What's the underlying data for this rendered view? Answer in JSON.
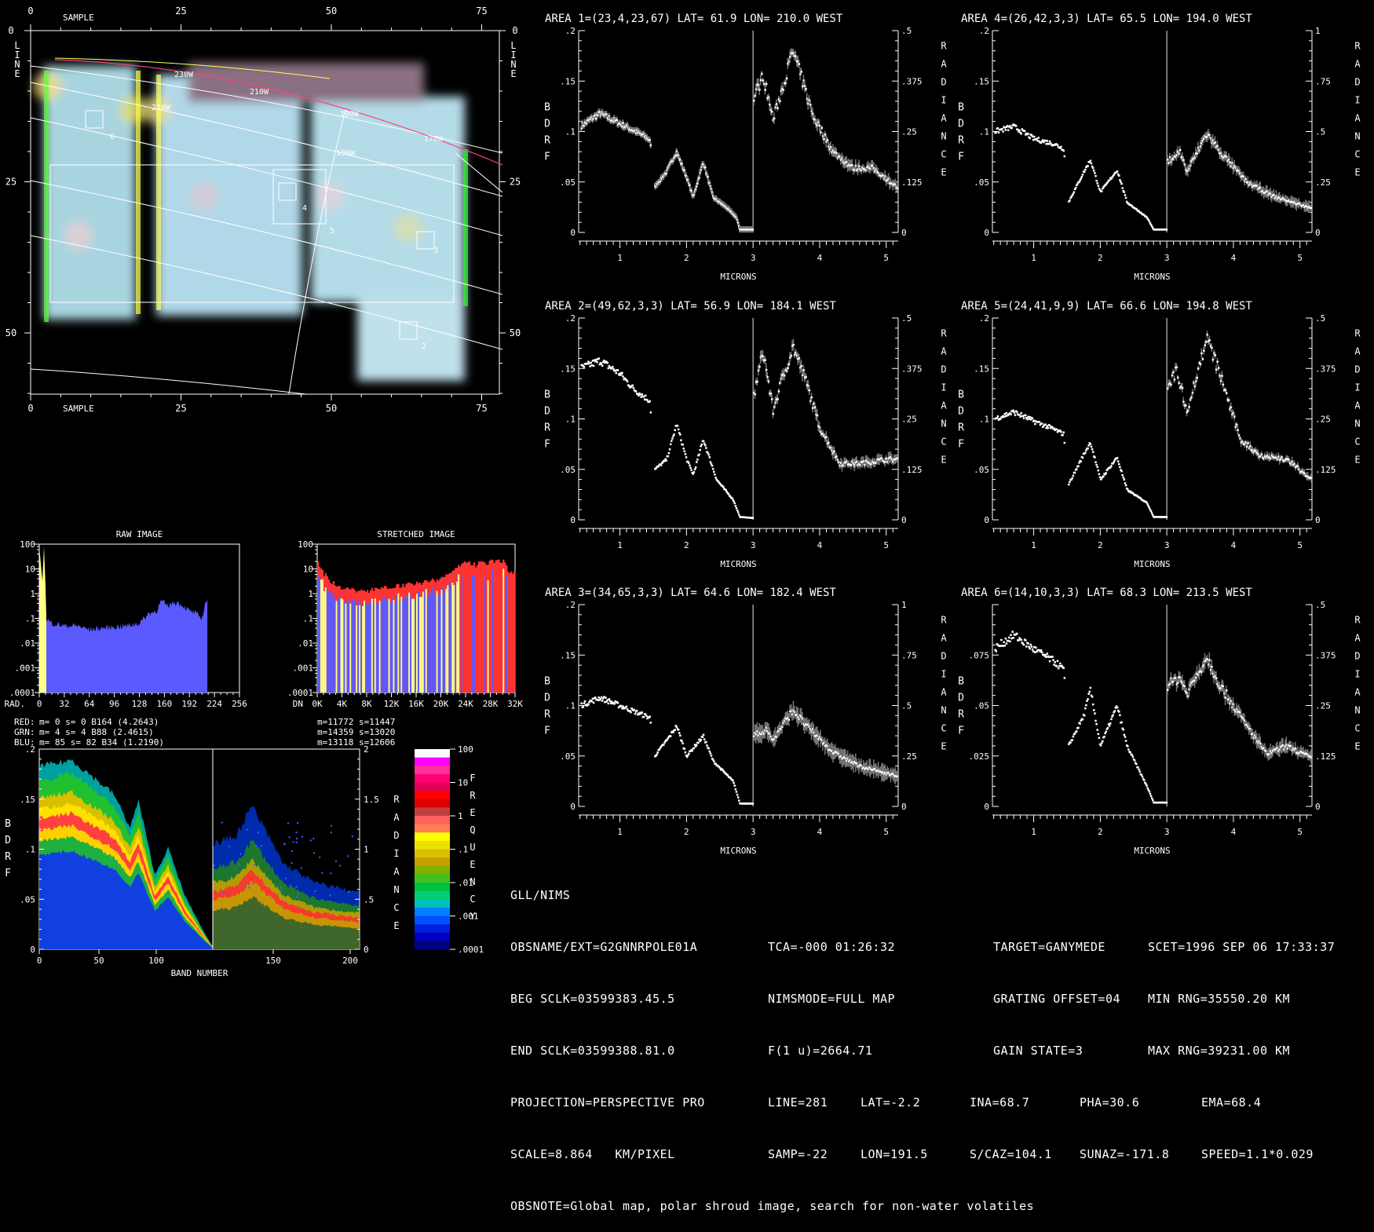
{
  "map": {
    "x_label": "SAMPLE",
    "y_label": "LINE",
    "x_ticks": [
      0,
      25,
      50,
      75
    ],
    "y_ticks": [
      0,
      25,
      50
    ],
    "longitude_labels": [
      "230W",
      "210W",
      "210W",
      "190W",
      "170W",
      "190W"
    ],
    "box_labels": [
      "6",
      "4",
      "5",
      "3",
      "2"
    ]
  },
  "spectrum_axes": {
    "xlabel": "MICRONS",
    "left_label": "BDRF",
    "right_label": "RADIANCE",
    "x_ticks": [
      1,
      2,
      3,
      4,
      5
    ],
    "x_range": [
      0.38,
      5.18
    ]
  },
  "areas": [
    {
      "title": "AREA 1=(23,4,23,67) LAT=  61.9 LON= 210.0 WEST",
      "bdrf_max": 0.2,
      "radiance_max": 0.5,
      "left_ticks": [
        ".2",
        ".15",
        ".1",
        ".05",
        "0"
      ],
      "right_ticks": [
        ".5",
        ".375",
        ".25",
        ".125",
        "0"
      ],
      "error": 0.02,
      "bdrf": [
        [
          0.4,
          0.105
        ],
        [
          0.7,
          0.118
        ],
        [
          1.0,
          0.108
        ],
        [
          1.3,
          0.098
        ],
        [
          1.45,
          0.092
        ],
        [
          1.52,
          0.045
        ],
        [
          1.7,
          0.06
        ],
        [
          1.85,
          0.08
        ],
        [
          2.0,
          0.055
        ],
        [
          2.1,
          0.035
        ],
        [
          2.25,
          0.07
        ],
        [
          2.4,
          0.035
        ],
        [
          2.6,
          0.025
        ],
        [
          2.75,
          0.015
        ],
        [
          2.8,
          0.003
        ],
        [
          3.0,
          0.003
        ]
      ],
      "radiance": [
        [
          3.0,
          0.33
        ],
        [
          3.15,
          0.39
        ],
        [
          3.3,
          0.28
        ],
        [
          3.6,
          0.45
        ],
        [
          3.9,
          0.29
        ],
        [
          4.2,
          0.2
        ],
        [
          4.5,
          0.16
        ],
        [
          4.8,
          0.16
        ],
        [
          5.18,
          0.11
        ]
      ]
    },
    {
      "title": "AREA 2=(49,62,3,3) LAT=  56.9 LON= 184.1 WEST",
      "bdrf_max": 0.2,
      "radiance_max": 0.5,
      "left_ticks": [
        ".2",
        ".15",
        ".1",
        ".05",
        "0"
      ],
      "right_ticks": [
        ".5",
        ".375",
        ".25",
        ".125",
        "0"
      ],
      "error": 0.02,
      "bdrf": [
        [
          0.4,
          0.15
        ],
        [
          0.7,
          0.158
        ],
        [
          1.0,
          0.145
        ],
        [
          1.2,
          0.13
        ],
        [
          1.45,
          0.118
        ],
        [
          1.52,
          0.05
        ],
        [
          1.7,
          0.06
        ],
        [
          1.85,
          0.095
        ],
        [
          2.0,
          0.06
        ],
        [
          2.1,
          0.045
        ],
        [
          2.25,
          0.08
        ],
        [
          2.45,
          0.04
        ],
        [
          2.7,
          0.02
        ],
        [
          2.8,
          0.003
        ],
        [
          3.0,
          0.002
        ]
      ],
      "radiance": [
        [
          3.0,
          0.3
        ],
        [
          3.15,
          0.42
        ],
        [
          3.3,
          0.27
        ],
        [
          3.4,
          0.33
        ],
        [
          3.6,
          0.43
        ],
        [
          3.8,
          0.34
        ],
        [
          4.0,
          0.23
        ],
        [
          4.3,
          0.14
        ],
        [
          4.6,
          0.14
        ],
        [
          5.0,
          0.15
        ],
        [
          5.18,
          0.15
        ]
      ]
    },
    {
      "title": "AREA 3=(34,65,3,3) LAT=  64.6 LON= 182.4 WEST",
      "bdrf_max": 0.2,
      "radiance_max": 1,
      "left_ticks": [
        ".2",
        ".15",
        ".1",
        ".05",
        "0"
      ],
      "right_ticks": [
        "1",
        ".75",
        ".5",
        ".25",
        "0"
      ],
      "error": 0.03,
      "bdrf": [
        [
          0.4,
          0.1
        ],
        [
          0.7,
          0.108
        ],
        [
          1.0,
          0.1
        ],
        [
          1.3,
          0.092
        ],
        [
          1.45,
          0.088
        ],
        [
          1.52,
          0.05
        ],
        [
          1.75,
          0.07
        ],
        [
          1.85,
          0.08
        ],
        [
          2.0,
          0.05
        ],
        [
          2.25,
          0.07
        ],
        [
          2.4,
          0.045
        ],
        [
          2.7,
          0.025
        ],
        [
          2.8,
          0.003
        ],
        [
          3.0,
          0.003
        ]
      ],
      "radiance": [
        [
          3.0,
          0.35
        ],
        [
          3.2,
          0.38
        ],
        [
          3.3,
          0.33
        ],
        [
          3.6,
          0.48
        ],
        [
          3.8,
          0.4
        ],
        [
          4.2,
          0.27
        ],
        [
          4.6,
          0.2
        ],
        [
          5.18,
          0.15
        ]
      ]
    },
    {
      "title": "AREA 4=(26,42,3,3) LAT=  65.5 LON= 194.0 WEST",
      "bdrf_max": 0.2,
      "radiance_max": 1,
      "left_ticks": [
        ".2",
        ".15",
        ".1",
        ".05",
        "0"
      ],
      "right_ticks": [
        "1",
        ".75",
        ".5",
        ".25",
        "0"
      ],
      "error": 0.02,
      "bdrf": [
        [
          0.4,
          0.1
        ],
        [
          0.7,
          0.105
        ],
        [
          1.0,
          0.093
        ],
        [
          1.3,
          0.088
        ],
        [
          1.45,
          0.083
        ],
        [
          1.52,
          0.03
        ],
        [
          1.75,
          0.06
        ],
        [
          1.85,
          0.072
        ],
        [
          2.0,
          0.04
        ],
        [
          2.25,
          0.062
        ],
        [
          2.4,
          0.03
        ],
        [
          2.7,
          0.015
        ],
        [
          2.8,
          0.003
        ],
        [
          3.0,
          0.003
        ]
      ],
      "radiance": [
        [
          3.0,
          0.35
        ],
        [
          3.2,
          0.4
        ],
        [
          3.3,
          0.3
        ],
        [
          3.6,
          0.49
        ],
        [
          3.8,
          0.4
        ],
        [
          4.2,
          0.25
        ],
        [
          4.6,
          0.18
        ],
        [
          5.18,
          0.12
        ]
      ]
    },
    {
      "title": "AREA 5=(24,41,9,9) LAT=  66.6 LON= 194.8 WEST",
      "bdrf_max": 0.2,
      "radiance_max": 0.5,
      "left_ticks": [
        ".2",
        ".15",
        ".1",
        ".05",
        "0"
      ],
      "right_ticks": [
        ".5",
        ".375",
        ".25",
        ".125",
        "0"
      ],
      "error": 0.015,
      "bdrf": [
        [
          0.4,
          0.1
        ],
        [
          0.7,
          0.107
        ],
        [
          1.0,
          0.098
        ],
        [
          1.3,
          0.09
        ],
        [
          1.45,
          0.085
        ],
        [
          1.52,
          0.035
        ],
        [
          1.75,
          0.065
        ],
        [
          1.85,
          0.077
        ],
        [
          2.0,
          0.04
        ],
        [
          2.25,
          0.062
        ],
        [
          2.4,
          0.03
        ],
        [
          2.7,
          0.017
        ],
        [
          2.8,
          0.003
        ],
        [
          3.0,
          0.003
        ]
      ],
      "radiance": [
        [
          3.0,
          0.33
        ],
        [
          3.15,
          0.37
        ],
        [
          3.3,
          0.27
        ],
        [
          3.6,
          0.45
        ],
        [
          3.8,
          0.36
        ],
        [
          4.1,
          0.2
        ],
        [
          4.4,
          0.16
        ],
        [
          4.8,
          0.15
        ],
        [
          5.18,
          0.1
        ]
      ]
    },
    {
      "title": "AREA 6=(14,10,3,3) LAT=  68.3 LON= 213.5 WEST",
      "bdrf_max": 0.1,
      "radiance_max": 0.5,
      "left_ticks": [
        "",
        ".075",
        ".05",
        ".025",
        "0"
      ],
      "right_ticks": [
        ".5",
        ".375",
        ".25",
        ".125",
        "0"
      ],
      "error": 0.025,
      "bdrf": [
        [
          0.4,
          0.078
        ],
        [
          0.7,
          0.085
        ],
        [
          1.0,
          0.078
        ],
        [
          1.3,
          0.072
        ],
        [
          1.45,
          0.068
        ],
        [
          1.52,
          0.03
        ],
        [
          1.75,
          0.045
        ],
        [
          1.85,
          0.058
        ],
        [
          2.0,
          0.03
        ],
        [
          2.25,
          0.05
        ],
        [
          2.4,
          0.03
        ],
        [
          2.7,
          0.01
        ],
        [
          2.8,
          0.002
        ],
        [
          3.0,
          0.002
        ]
      ],
      "radiance": [
        [
          3.0,
          0.3
        ],
        [
          3.2,
          0.32
        ],
        [
          3.3,
          0.28
        ],
        [
          3.6,
          0.37
        ],
        [
          3.8,
          0.3
        ],
        [
          4.2,
          0.2
        ],
        [
          4.5,
          0.13
        ],
        [
          4.8,
          0.15
        ],
        [
          5.18,
          0.12
        ]
      ]
    }
  ],
  "histograms": {
    "y_ticks": [
      "100",
      "10",
      "1",
      ".1",
      ".01",
      ".001",
      ".0001"
    ],
    "raw": {
      "title": "RAW IMAGE",
      "x_label": "RAD.",
      "x_ticks": [
        "0",
        "32",
        "64",
        "96",
        "128",
        "160",
        "192",
        "224",
        "256"
      ],
      "x_max": 256,
      "blue_log": [
        [
          0,
          0.5
        ],
        [
          3,
          -0.3
        ],
        [
          8,
          -1.0
        ],
        [
          16,
          -1.2
        ],
        [
          32,
          -1.3
        ],
        [
          48,
          -1.3
        ],
        [
          64,
          -1.45
        ],
        [
          80,
          -1.4
        ],
        [
          96,
          -1.35
        ],
        [
          112,
          -1.3
        ],
        [
          128,
          -1.2
        ],
        [
          140,
          -0.8
        ],
        [
          150,
          -0.7
        ],
        [
          156,
          -0.3
        ],
        [
          164,
          -0.5
        ],
        [
          172,
          -0.35
        ],
        [
          180,
          -0.4
        ],
        [
          192,
          -0.7
        ],
        [
          200,
          -0.8
        ],
        [
          208,
          -1.0
        ],
        [
          213,
          -0.3
        ],
        [
          215,
          -0.3
        ]
      ],
      "yellow_log": [
        [
          0,
          1.9
        ],
        [
          4,
          0.5
        ],
        [
          6,
          1.9
        ],
        [
          8,
          0.3
        ],
        [
          9,
          -0.9
        ]
      ]
    },
    "stretched": {
      "title": "STRETCHED IMAGE",
      "x_label": "DN",
      "x_ticks": [
        "0K",
        "4K",
        "8K",
        "12K",
        "16K",
        "20K",
        "24K",
        "28K",
        "32K"
      ],
      "x_max": 32,
      "red_log": [
        [
          0,
          1.3
        ],
        [
          1,
          0.8
        ],
        [
          2,
          0.5
        ],
        [
          4,
          0.2
        ],
        [
          8,
          0.1
        ],
        [
          12,
          0.3
        ],
        [
          16,
          0.4
        ],
        [
          20,
          0.6
        ],
        [
          22,
          1.0
        ],
        [
          24,
          1.3
        ],
        [
          26,
          1.1
        ],
        [
          28,
          1.3
        ],
        [
          30,
          1.3
        ],
        [
          31,
          0.8
        ],
        [
          32,
          0.8
        ]
      ]
    },
    "stats": [
      {
        "label": "RED:",
        "text": "m=    0 s=    0 B164 (4.2643)",
        "stretched": "m=11772 s=11447",
        "color": "#ff3333"
      },
      {
        "label": "GRN:",
        "text": "m=    4 s=    4 B88  (2.4615)",
        "stretched": "m=14359 s=13020",
        "color": "#ffff88"
      },
      {
        "label": "BLU:",
        "text": "m=   85 s=   82 B34  (1.2190)",
        "stretched": "m=13118 s=12606",
        "color": "#6666ff"
      }
    ]
  },
  "cube": {
    "xlabel": "BAND NUMBER",
    "left_label": "BDRF",
    "right_label": "RADIANCE",
    "x_ticks": [
      "0",
      "50",
      "100",
      "150",
      "200"
    ],
    "left_ticks": [
      ".2",
      ".15",
      ".1",
      ".05",
      "0"
    ],
    "right_ticks": [
      "2",
      "1.5",
      "1",
      ".5",
      "0"
    ]
  },
  "colorbar": {
    "label": "FREQUENCY",
    "ticks": [
      "100",
      "10",
      "1",
      ".1",
      ".01",
      ".001",
      ".0001"
    ],
    "colors": [
      "#ffffff",
      "#ff00ff",
      "#ff3399",
      "#ff0077",
      "#e0005a",
      "#ff0000",
      "#dd0000",
      "#c04040",
      "#ff6060",
      "#ff8050",
      "#ffff00",
      "#f0e000",
      "#d8c000",
      "#c8a000",
      "#80b000",
      "#40c020",
      "#00c040",
      "#00d070",
      "#00c0c0",
      "#0080ff",
      "#0050ff",
      "#0020e0",
      "#0000c0",
      "#000080"
    ]
  },
  "colors": {
    "red": "#ff3333",
    "yellow": "#ffff88",
    "blue": "#5a5aff"
  },
  "info": {
    "title": "GLL/NIMS",
    "rows": [
      [
        "OBSNAME/EXT=G2GNNRPOLE01A",
        "TCA=-000 01:26:32",
        "TARGET=GANYMEDE",
        "SCET=1996 SEP 06 17:33:37"
      ],
      [
        "BEG SCLK=03599383.45.5",
        "NIMSMODE=FULL MAP",
        "GRATING OFFSET=04",
        "MIN RNG=35550.20 KM"
      ],
      [
        "END SCLK=03599388.81.0",
        "F(1 u)=2664.71",
        "GAIN STATE=3",
        "MAX RNG=39231.00 KM"
      ]
    ],
    "row_projection": [
      "PROJECTION=PERSPECTIVE PRO",
      "LINE=281",
      "LAT=-2.2",
      "INA=68.7",
      "PHA=30.6",
      "EMA=68.4"
    ],
    "row_scale": [
      "SCALE=8.864   KM/PIXEL",
      "SAMP=-22",
      "LON=191.5",
      "S/CAZ=104.1",
      "SUNAZ=-171.8",
      "SPEED=1.1*0.029"
    ],
    "obsnote": "OBSNOTE=Global map, polar shroud image, search for non-water volatiles"
  }
}
